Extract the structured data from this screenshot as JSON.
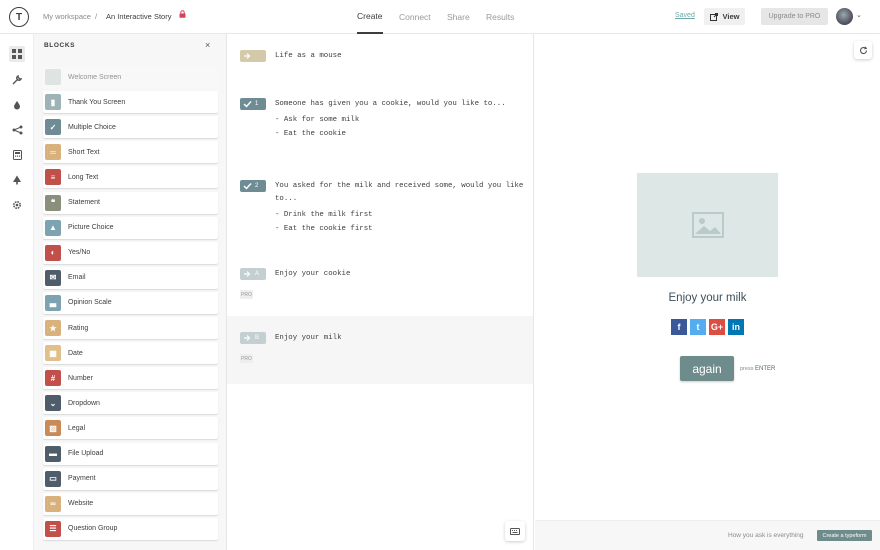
{
  "header": {
    "logo_letter": "T",
    "workspace": "My workspace",
    "separator": "/",
    "form_title": "An Interactive Story",
    "tabs": [
      {
        "label": "Create",
        "active": true
      },
      {
        "label": "Connect",
        "active": false
      },
      {
        "label": "Share",
        "active": false
      },
      {
        "label": "Results",
        "active": false
      }
    ],
    "saved_label": "Saved",
    "view_label": "View",
    "upgrade_label": "Upgrade to PRO"
  },
  "panel": {
    "title": "BLOCKS",
    "close": "×",
    "blocks": [
      {
        "label": "Welcome Screen",
        "color": "#c9d6d2",
        "glyph": "",
        "disabled": true
      },
      {
        "label": "Thank You Screen",
        "color": "#9db3b7",
        "glyph": "▮",
        "disabled": false
      },
      {
        "label": "Multiple Choice",
        "color": "#6f8c95",
        "glyph": "✓",
        "disabled": false
      },
      {
        "label": "Short Text",
        "color": "#d8b17c",
        "glyph": "═",
        "disabled": false
      },
      {
        "label": "Long Text",
        "color": "#c2504a",
        "glyph": "≡",
        "disabled": false
      },
      {
        "label": "Statement",
        "color": "#8a8f7c",
        "glyph": "❝",
        "disabled": false
      },
      {
        "label": "Picture Choice",
        "color": "#7ea3b0",
        "glyph": "▲",
        "disabled": false
      },
      {
        "label": "Yes/No",
        "color": "#c2504a",
        "glyph": "◐",
        "disabled": false
      },
      {
        "label": "Email",
        "color": "#4f5d6b",
        "glyph": "✉",
        "disabled": false
      },
      {
        "label": "Opinion Scale",
        "color": "#7ea3b0",
        "glyph": "▃",
        "disabled": false
      },
      {
        "label": "Rating",
        "color": "#d8b17c",
        "glyph": "★",
        "disabled": false
      },
      {
        "label": "Date",
        "color": "#e0bf8a",
        "glyph": "▦",
        "disabled": false
      },
      {
        "label": "Number",
        "color": "#c2504a",
        "glyph": "#",
        "disabled": false
      },
      {
        "label": "Dropdown",
        "color": "#4f5d6b",
        "glyph": "⌄",
        "disabled": false
      },
      {
        "label": "Legal",
        "color": "#c98a5a",
        "glyph": "▧",
        "disabled": false
      },
      {
        "label": "File Upload",
        "color": "#4f5d6b",
        "glyph": "▬",
        "disabled": false
      },
      {
        "label": "Payment",
        "color": "#4f5d6b",
        "glyph": "▭",
        "disabled": false
      },
      {
        "label": "Website",
        "color": "#d8b17c",
        "glyph": "∞",
        "disabled": false
      },
      {
        "label": "Question Group",
        "color": "#c2504a",
        "glyph": "☰",
        "disabled": false
      }
    ]
  },
  "questions": [
    {
      "tag_color": "#d4c9a8",
      "tag_text": "",
      "text": "Life as a mouse",
      "options": [],
      "pro": false
    },
    {
      "tag_color": "#6f8c95",
      "tag_text": "1",
      "text": "Someone has given you a cookie, would you like to...",
      "options": [
        "- Ask for some milk",
        "- Eat the cookie"
      ],
      "pro": false
    },
    {
      "tag_color": "#6f8c95",
      "tag_text": "2",
      "text": "You asked for the milk and received some, would you like to...",
      "options": [
        "- Drink the milk first",
        "- Eat the cookie first"
      ],
      "pro": false
    },
    {
      "tag_color": "#c3cfd0",
      "tag_text": "A",
      "text": "Enjoy your cookie",
      "options": [],
      "pro": true
    },
    {
      "tag_color": "#c3cfd0",
      "tag_text": "B",
      "text": "Enjoy your milk",
      "options": [],
      "pro": true
    }
  ],
  "pro_label": "PRO",
  "preview": {
    "title": "Enjoy your milk",
    "social": [
      {
        "name": "facebook-icon",
        "color": "#3b5998",
        "glyph": "f"
      },
      {
        "name": "twitter-icon",
        "color": "#55acee",
        "glyph": "t"
      },
      {
        "name": "google-plus-icon",
        "color": "#dc4e41",
        "glyph": "G+"
      },
      {
        "name": "linkedin-icon",
        "color": "#0077b5",
        "glyph": "in"
      }
    ],
    "button_label": "again",
    "hint_press": "press",
    "hint_key": "ENTER"
  },
  "footer": {
    "tagline": "How you ask is everything",
    "cta": "Create a typeform"
  }
}
